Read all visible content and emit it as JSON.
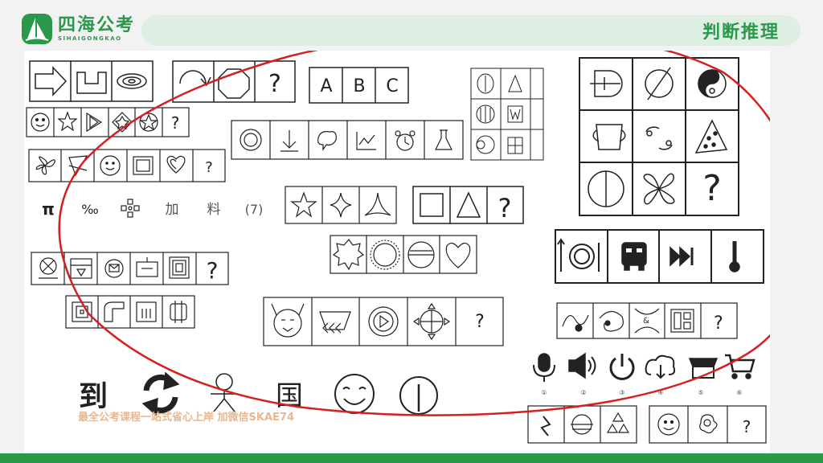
{
  "header": {
    "logo_cn": "四海公考",
    "logo_en": "SIHAIGONGKAO",
    "section_title": "判断推理"
  },
  "panels": {
    "abc": [
      "A",
      "B",
      "C"
    ],
    "misc_row": [
      "π",
      "‰",
      "加",
      "料",
      "(7)"
    ],
    "chars_row": [
      "到",
      "国"
    ],
    "option_numbers": [
      "①",
      "②",
      "③",
      "④",
      "⑤",
      "⑥"
    ],
    "question_mark": "?"
  },
  "watermark": "最全公考课程一站式省心上岸 加微信SKAE74",
  "colors": {
    "brand": "#2a9a4a",
    "bar_light": "#dfeee3",
    "bottom_bar": "#2b9a47",
    "annotation": "#d42020"
  }
}
